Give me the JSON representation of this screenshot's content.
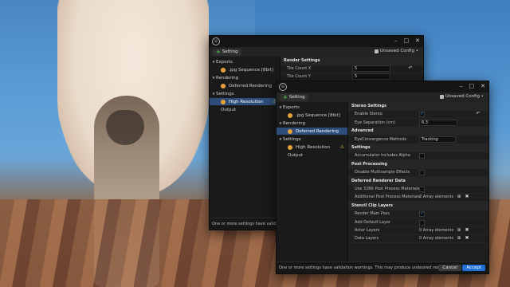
{
  "back_window": {
    "logo": "U",
    "toolbar": {
      "setting_label": "Setting",
      "config_label": "Unsaved Config •"
    },
    "tree": [
      {
        "label": "Exports",
        "level": 0,
        "arrow": "▼"
      },
      {
        "label": ".jpg Sequence [8bit]",
        "level": 1,
        "toggle": true
      },
      {
        "label": "Rendering",
        "level": 0,
        "arrow": "▼"
      },
      {
        "label": "Deferred Rendering",
        "level": 1,
        "toggle": true
      },
      {
        "label": "Settings",
        "level": 0,
        "arrow": "▼"
      },
      {
        "label": "High Resolution",
        "level": 1,
        "toggle": true,
        "selected": true,
        "warning": true
      },
      {
        "label": "Output",
        "level": 1
      }
    ],
    "panel": {
      "section": "Render Settings",
      "rows": [
        {
          "label": "Tile Count X",
          "value": "5"
        },
        {
          "label": "Tile Count Y",
          "value": "5"
        }
      ]
    },
    "status": "One or more settings have validation w"
  },
  "front_window": {
    "logo": "U",
    "toolbar": {
      "setting_label": "Setting",
      "config_label": "Unsaved Config •"
    },
    "tree": [
      {
        "label": "Exports",
        "level": 0,
        "arrow": "▼"
      },
      {
        "label": ".jpg Sequence [8bit]",
        "level": 1,
        "toggle": true
      },
      {
        "label": "Rendering",
        "level": 0,
        "arrow": "▼"
      },
      {
        "label": "Deferred Rendering",
        "level": 1,
        "toggle": true,
        "selected": true
      },
      {
        "label": "Settings",
        "level": 0,
        "arrow": "▼"
      },
      {
        "label": "High Resolution",
        "level": 1,
        "toggle": true,
        "warning": true
      },
      {
        "label": "Output",
        "level": 1
      }
    ],
    "panel_rows": [
      {
        "kind": "section",
        "label": "Stereo Settings"
      },
      {
        "kind": "check",
        "label": "Enable Stereo",
        "checked": true,
        "reset": true
      },
      {
        "kind": "field",
        "label": "Eye Separation (cm)",
        "value": "6.3"
      },
      {
        "kind": "section",
        "label": "Advanced"
      },
      {
        "kind": "dropdown",
        "label": "EyeConvergence Methods",
        "value": "Tracking"
      },
      {
        "kind": "section",
        "label": "Settings"
      },
      {
        "kind": "check",
        "label": "Accumulator Includes Alpha",
        "checked": false
      },
      {
        "kind": "section",
        "label": "Post Processing"
      },
      {
        "kind": "check",
        "label": "Disable Multisample Effects",
        "checked": false
      },
      {
        "kind": "section",
        "label": "Deferred Renderer Data"
      },
      {
        "kind": "check",
        "label": "Use 32Bit Post Process Materials",
        "checked": false
      },
      {
        "kind": "array",
        "label": "Additional Post Process Materials",
        "value": "2 Array elements"
      },
      {
        "kind": "section",
        "label": "Stencil Clip Layers"
      },
      {
        "kind": "check",
        "label": "Render Main Pass",
        "checked": true
      },
      {
        "kind": "check",
        "label": "Add Default Layer",
        "checked": false
      },
      {
        "kind": "array",
        "label": "Actor Layers",
        "value": "0 Array elements"
      },
      {
        "kind": "array",
        "label": "Data Layers",
        "value": "0 Array elements"
      }
    ],
    "status": "One or more settings have validation warnings. This may produce undesired results",
    "cancel_label": "Cancel",
    "accept_label": "Accept"
  },
  "colors": {
    "accent": "#1e6fd6",
    "selected_row": "#2d4e7a",
    "toggle": "#e4a23a",
    "warning": "#e6c23a",
    "plus": "#4fc64a"
  },
  "icons": {
    "reset": "↶",
    "add": "⊕",
    "delete": "✖",
    "warning": "⚠",
    "minimize": "–",
    "maximize": "□",
    "close": "✕"
  }
}
